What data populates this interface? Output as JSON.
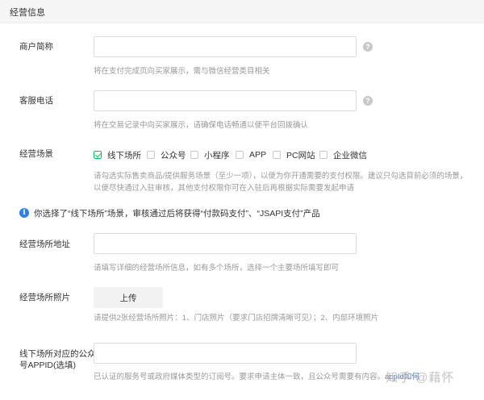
{
  "section": {
    "title": "经营信息"
  },
  "merchant_name": {
    "label": "商户简称",
    "value": "",
    "placeholder": "",
    "hint": "将在支付完成页向买家展示，需与微信经营类目相关"
  },
  "service_phone": {
    "label": "客服电话",
    "value": "",
    "placeholder": "",
    "hint": "将在交易记录中向买家展示，请确保电话畅通以便平台回拨确认"
  },
  "business_scenes": {
    "label": "经营场景",
    "options": [
      {
        "label": "线下场所",
        "checked": true
      },
      {
        "label": "公众号",
        "checked": false
      },
      {
        "label": "小程序",
        "checked": false
      },
      {
        "label": "APP",
        "checked": false
      },
      {
        "label": "PC网站",
        "checked": false
      },
      {
        "label": "企业微信",
        "checked": false
      }
    ],
    "hint_lines": [
      "请勾选实际售卖商品/提供服务场景（至少一项），以便为你开通需要的支付权限。建议只勾选目前必须的场景，",
      "以便尽快通过入驻审核，其他支付权限你可在入驻后再根据实际需要发起申请"
    ]
  },
  "notice": {
    "text": "你选择了“线下场所”场景，审核通过后将获得“付款码支付”、“JSAPI支付”产品",
    "accent_color": "#2f80ed"
  },
  "store_address": {
    "label": "经营场所地址",
    "value": "",
    "hint": "请填写详细的经营场所信息，如有多个场所，选择一个主要场所填写即可"
  },
  "store_photos": {
    "label": "经营场所照片",
    "button_label": "上传",
    "hint": "请提供2张经营场所照片：1、门店照片（要求门店招牌清晰可见）；2、内部环境照片"
  },
  "appid": {
    "label_line1": "线下场所对应的公众",
    "label_line2": "号APPID(选填)",
    "value": "",
    "hint": "已认证的服务号或政府媒体类型的订阅号。要求申请主体一致，且公众号需要有内容。",
    "hint_tail": "appId如何"
  },
  "watermark": "知乎 @藉怀",
  "colors": {
    "checkbox_checked": "#07c160",
    "hint_text": "#999999",
    "header_bg": "#f5f5f5"
  }
}
